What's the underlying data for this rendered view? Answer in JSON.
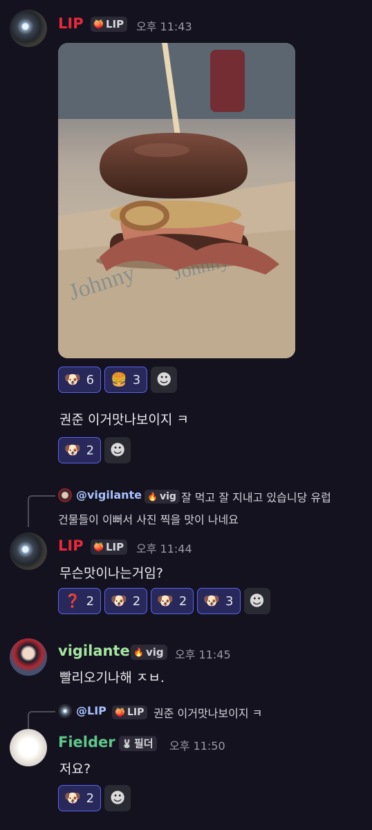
{
  "colors": {
    "background": "#14121f",
    "lip_name": "#e8283c",
    "vigilante_name": "#a6e6a0",
    "fielder_name": "#5ec98a",
    "mention": "#a9c2ff",
    "reaction_active_bg": "#28285a",
    "reaction_active_border": "#5865f2"
  },
  "messages": [
    {
      "author": "LIP",
      "role_icon": "peach-icon",
      "role_emoji": "🍑",
      "role": "LIP",
      "time": "오후 11:43",
      "image": "burger-photo",
      "reactions": [
        {
          "emoji": "🐶",
          "icon": "dog-question-icon",
          "count": "6"
        },
        {
          "emoji": "🍔",
          "icon": "burger-icon",
          "count": "3"
        }
      ],
      "text": "권준 이거맛나보이지 ㅋ",
      "text_reactions": [
        {
          "emoji": "🐶",
          "icon": "dog-exclaim-icon",
          "count": "2"
        }
      ]
    },
    {
      "reply": {
        "author": "@vigilante",
        "role_icon": "flame-icon",
        "role_emoji": "🔥",
        "role": "vig",
        "text_line1": "잘 먹고 잘 지내고 있습니당 유럽",
        "text_line2": "건물들이 이뻐서 사진 찍을 맛이 나네요"
      },
      "author": "LIP",
      "role_icon": "peach-icon",
      "role_emoji": "🍑",
      "role": "LIP",
      "time": "오후 11:44",
      "text": "무슨맛이나는거임?",
      "reactions": [
        {
          "emoji": "❓",
          "icon": "question-icon",
          "count": "2"
        },
        {
          "emoji": "🐶",
          "icon": "dog-question-icon",
          "count": "2"
        },
        {
          "emoji": "🐶",
          "icon": "dog-icon",
          "count": "2"
        },
        {
          "emoji": "🐶",
          "icon": "dog-dots-icon",
          "count": "3"
        }
      ]
    },
    {
      "author": "vigilante",
      "role_icon": "flame-icon",
      "role_emoji": "🔥",
      "role": "vig",
      "time": "오후 11:45",
      "text": "빨리오기나해 ㅈㅂ."
    },
    {
      "reply": {
        "author": "@LIP",
        "role_icon": "peach-icon",
        "role_emoji": "🍑",
        "role": "LIP",
        "text_line1": "권준 이거맛나보이지 ㅋ"
      },
      "author": "Fielder",
      "role_icon": "bunny-icon",
      "role_emoji": "🐰",
      "role": "필더",
      "time": "오후 11:50",
      "text": "저요?",
      "reactions": [
        {
          "emoji": "🐶",
          "icon": "dog-exclaim-icon",
          "count": "2"
        }
      ]
    }
  ],
  "add_reaction_icon": "☻"
}
